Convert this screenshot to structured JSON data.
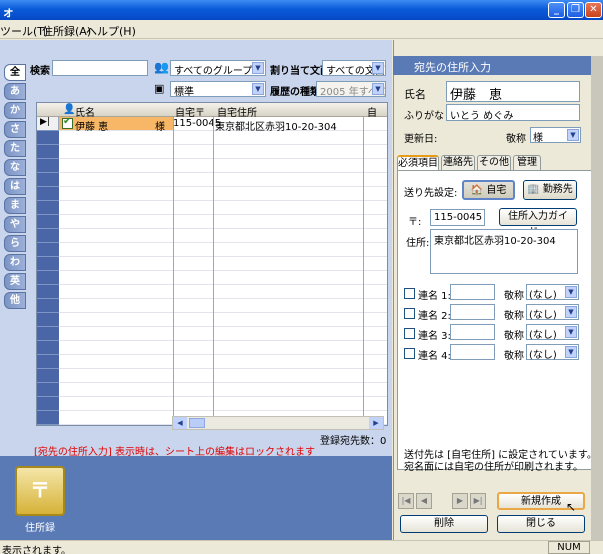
{
  "window": {
    "title": "ォ"
  },
  "menu": [
    {
      "label": "ツール(T)"
    },
    {
      "label": "住所録(A)"
    },
    {
      "label": "ヘルプ(H)"
    }
  ],
  "toolbar": {
    "search_label": "検索",
    "search_value": "",
    "group_select": "すべてのグループ",
    "assign_label": "割り当て文面",
    "assign_select": "すべての文面",
    "view_select": "標準",
    "history_label": "履歴の種類",
    "history_select": "2005 年すべて"
  },
  "alpha_tabs": [
    "全",
    "あ",
    "か",
    "さ",
    "た",
    "な",
    "は",
    "ま",
    "や",
    "ら",
    "わ",
    "英",
    "他"
  ],
  "grid": {
    "columns": [
      "氏名",
      "自宅〒",
      "自宅住所"
    ],
    "rows": [
      {
        "name": "伊藤 恵",
        "honorific": "様",
        "zip": "115-0045",
        "address": "東京都北区赤羽10-20-304"
      }
    ],
    "count_label": "登録宛先数：0"
  },
  "notice": "[宛先の住所入力] 表示時は、シート上の編集はロックされます",
  "dock": {
    "label": "住所録"
  },
  "panel": {
    "header": "宛先の住所入力",
    "name_label": "氏名",
    "name_value": "伊藤　恵",
    "kana_label": "ふりがな",
    "kana_value": "いとう めぐみ",
    "updated_label": "更新日:",
    "honorific_label": "敬称",
    "honorific_value": "様",
    "tabs": [
      "必須項目",
      "連絡先",
      "その他",
      "管理"
    ],
    "send_label": "送り先設定:",
    "home_btn": "自宅",
    "work_btn": "勤務先",
    "zip_label": "〒:",
    "zip_value": "115-0045",
    "guide_btn": "住所入力ガイド...",
    "addr_label": "住所:",
    "addr_value": "東京都北区赤羽10-20-304",
    "joint_rows": [
      {
        "label": "連名 1:",
        "honorific_label": "敬称",
        "honorific": "(なし)"
      },
      {
        "label": "連名 2:",
        "honorific_label": "敬称",
        "honorific": "(なし)"
      },
      {
        "label": "連名 3:",
        "honorific_label": "敬称",
        "honorific": "(なし)"
      },
      {
        "label": "連名 4:",
        "honorific_label": "敬称",
        "honorific": "(なし)"
      }
    ],
    "info_line1": "送付先は [自宅住所] に設定されています。",
    "info_line2": "宛名面には自宅の住所が印刷されます。",
    "new_btn": "新規作成",
    "delete_btn": "削除",
    "close_btn": "閉じる"
  },
  "status": {
    "message": "表示されます。",
    "num": "NUM"
  }
}
